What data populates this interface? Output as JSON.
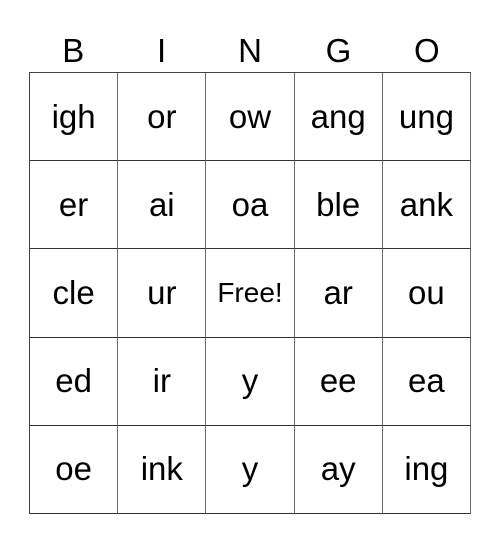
{
  "header": [
    "B",
    "I",
    "N",
    "G",
    "O"
  ],
  "rows": [
    [
      "igh",
      "or",
      "ow",
      "ang",
      "ung"
    ],
    [
      "er",
      "ai",
      "oa",
      "ble",
      "ank"
    ],
    [
      "cle",
      "ur",
      "Free!",
      "ar",
      "ou"
    ],
    [
      "ed",
      "ir",
      "y",
      "ee",
      "ea"
    ],
    [
      "oe",
      "ink",
      "y",
      "ay",
      "ing"
    ]
  ]
}
